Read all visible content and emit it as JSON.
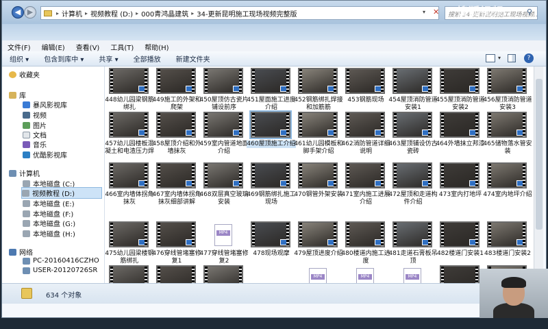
{
  "address": {
    "segments": [
      "计算机",
      "视频教程 (D:)",
      "000青鸿晶建筑",
      "34-更新昆明施工现场视频完整版"
    ]
  },
  "search": {
    "placeholder": "搜索 34-更新昆明施工现场视频..."
  },
  "watermark": "搜狐视频",
  "menu": [
    "文件(F)",
    "编辑(E)",
    "查看(V)",
    "工具(T)",
    "帮助(H)"
  ],
  "toolbar": [
    "组织 ▾",
    "包含到库中 ▾",
    "共享 ▾",
    "全部播放",
    "新建文件夹"
  ],
  "sidebar": {
    "favorites": "收藏夹",
    "library": "库",
    "library_items": [
      "暴风影视库",
      "视频",
      "图片",
      "文档",
      "音乐",
      "优酷影视库"
    ],
    "computer": "计算机",
    "drives": [
      "本地磁盘 (C:)",
      "视频教程 (D:)",
      "本地磁盘 (E:)",
      "本地磁盘 (F:)",
      "本地磁盘 (G:)",
      "本地磁盘 (H:)"
    ],
    "network": "网络",
    "network_items": [
      "PC-20160416CZHO",
      "USER-20120726SR"
    ]
  },
  "files": [
    {
      "label": "448幼儿园梁钢筋绑扎",
      "type": "video"
    },
    {
      "label": "449施工的外架和爬架",
      "type": "video"
    },
    {
      "label": "450屋顶仿古瓷片铺设前序",
      "type": "video"
    },
    {
      "label": "451屋面施工进度介绍",
      "type": "video"
    },
    {
      "label": "452钢筋绑扎焊接和加筋筋",
      "type": "video"
    },
    {
      "label": "453钢筋现场",
      "type": "video"
    },
    {
      "label": "454屋顶消防管道安装1",
      "type": "video"
    },
    {
      "label": "455屋顶消防管道安装2",
      "type": "video"
    },
    {
      "label": "456屋顶消防管道安装3",
      "type": "video"
    },
    {
      "label": "457幼儿园楼板混凝土和电渣压力焊",
      "type": "video"
    },
    {
      "label": "458屋顶介绍和外墙抹灰",
      "type": "video"
    },
    {
      "label": "459室内管道地面介绍",
      "type": "video"
    },
    {
      "label": "460屋顶施工介绍",
      "type": "video",
      "selected": true
    },
    {
      "label": "461幼儿园模板和脚手架介绍",
      "type": "video"
    },
    {
      "label": "462消防管道详细说明",
      "type": "video"
    },
    {
      "label": "463屋顶铺设仿古瓷砖",
      "type": "video"
    },
    {
      "label": "464外墙抹立邦漆",
      "type": "video"
    },
    {
      "label": "465储物落水管安装",
      "type": "video"
    },
    {
      "label": "466室内墙体拐角抹灰",
      "type": "video"
    },
    {
      "label": "467室内墙体拐角抹灰细部讲解",
      "type": "video"
    },
    {
      "label": "468双层真空玻璃安装",
      "type": "video"
    },
    {
      "label": "469钢筋绑扎施工现场",
      "type": "video"
    },
    {
      "label": "470钢管外架安装",
      "type": "video"
    },
    {
      "label": "471室内施工进展介绍",
      "type": "video"
    },
    {
      "label": "472屋顶和走道构件介绍",
      "type": "video"
    },
    {
      "label": "473室内打地坪",
      "type": "video"
    },
    {
      "label": "474室内地坪介绍",
      "type": "video"
    },
    {
      "label": "475幼儿园梁楼钢筋绑扎",
      "type": "video"
    },
    {
      "label": "476穿线管堵塞修复1",
      "type": "video"
    },
    {
      "label": "477穿线管堵塞修复2",
      "type": "mp4"
    },
    {
      "label": "478现场观摩",
      "type": "video"
    },
    {
      "label": "479屋顶进度介绍",
      "type": "video"
    },
    {
      "label": "480楼道内施工进度",
      "type": "video"
    },
    {
      "label": "481走道石膏板吊顶",
      "type": "video"
    },
    {
      "label": "482楼道门安装1",
      "type": "video"
    },
    {
      "label": "483楼道门安装2",
      "type": "video"
    },
    {
      "label": "",
      "type": "video"
    },
    {
      "label": "",
      "type": "video"
    },
    {
      "label": "",
      "type": "video"
    },
    {
      "label": "",
      "type": "blank"
    },
    {
      "label": "",
      "type": "mp4"
    },
    {
      "label": "",
      "type": "mp4"
    },
    {
      "label": "",
      "type": "mp4"
    },
    {
      "label": "",
      "type": "video"
    },
    {
      "label": "",
      "type": "video"
    }
  ],
  "mp4_tag": "MP4",
  "status": {
    "count": "634 个对象"
  },
  "colors": {
    "selection": "#cde3f7",
    "thumb_badge": "#2f6fc2",
    "mp4_tag": "#9b86c6"
  }
}
